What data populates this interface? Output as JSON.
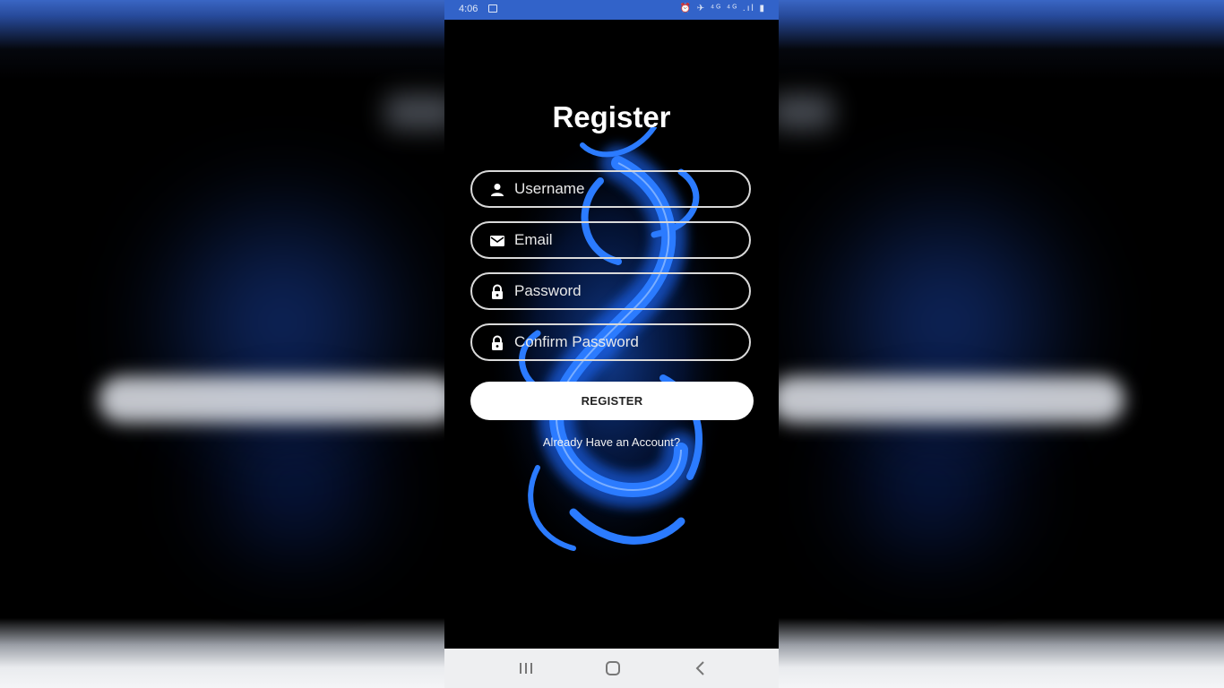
{
  "status_bar": {
    "time": "4:06",
    "icons_text": "⏰ ✈ ⁴ᴳ ⁴ᴳ .ıl ▮"
  },
  "screen": {
    "title": "Register",
    "fields": {
      "username": {
        "placeholder": "Username",
        "value": "",
        "icon": "person-icon"
      },
      "email": {
        "placeholder": "Email",
        "value": "",
        "icon": "mail-icon"
      },
      "password": {
        "placeholder": "Password",
        "value": "",
        "icon": "lock-icon"
      },
      "confirm_password": {
        "placeholder": "Confirm Password",
        "value": "",
        "icon": "lock-icon"
      }
    },
    "register_button": "REGISTER",
    "login_link": "Already Have an Account?"
  },
  "nav_bar": {
    "recent": "recent-apps-icon",
    "home": "home-icon",
    "back": "back-icon"
  },
  "colors": {
    "status_bar": "#3263c9",
    "background": "#000000",
    "dragon_blue": "#1f6bff",
    "button_bg": "#ffffff",
    "field_border": "#d9d9d9"
  }
}
